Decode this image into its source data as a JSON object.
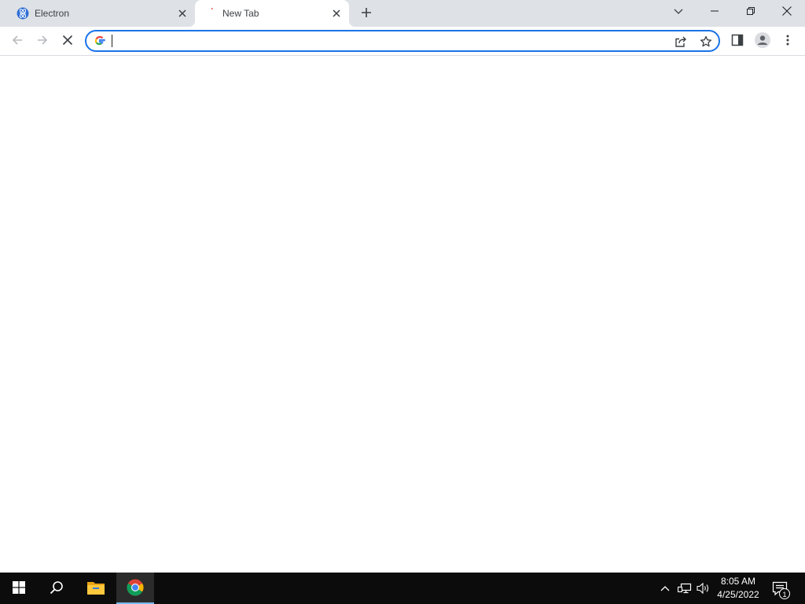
{
  "tabs": [
    {
      "title": "Electron",
      "favicon": "electron-icon",
      "active": false
    },
    {
      "title": "New Tab",
      "favicon": "loading-throbber-icon",
      "active": true
    }
  ],
  "omnibox": {
    "value": "",
    "placeholder": "",
    "focused": true
  },
  "taskbar": {
    "pinned": [
      "windows-start-icon",
      "search-icon",
      "file-explorer-icon",
      "chrome-icon"
    ],
    "active_app": "chrome-icon",
    "clock": {
      "time": "8:05 AM",
      "date": "4/25/2022"
    },
    "notification_count": "1"
  },
  "colors": {
    "tabstrip": "#dee1e6",
    "omnibox_focus": "#1a73e8",
    "taskbar": "#0c0c0c",
    "active_app_indicator": "#76b9ed"
  }
}
